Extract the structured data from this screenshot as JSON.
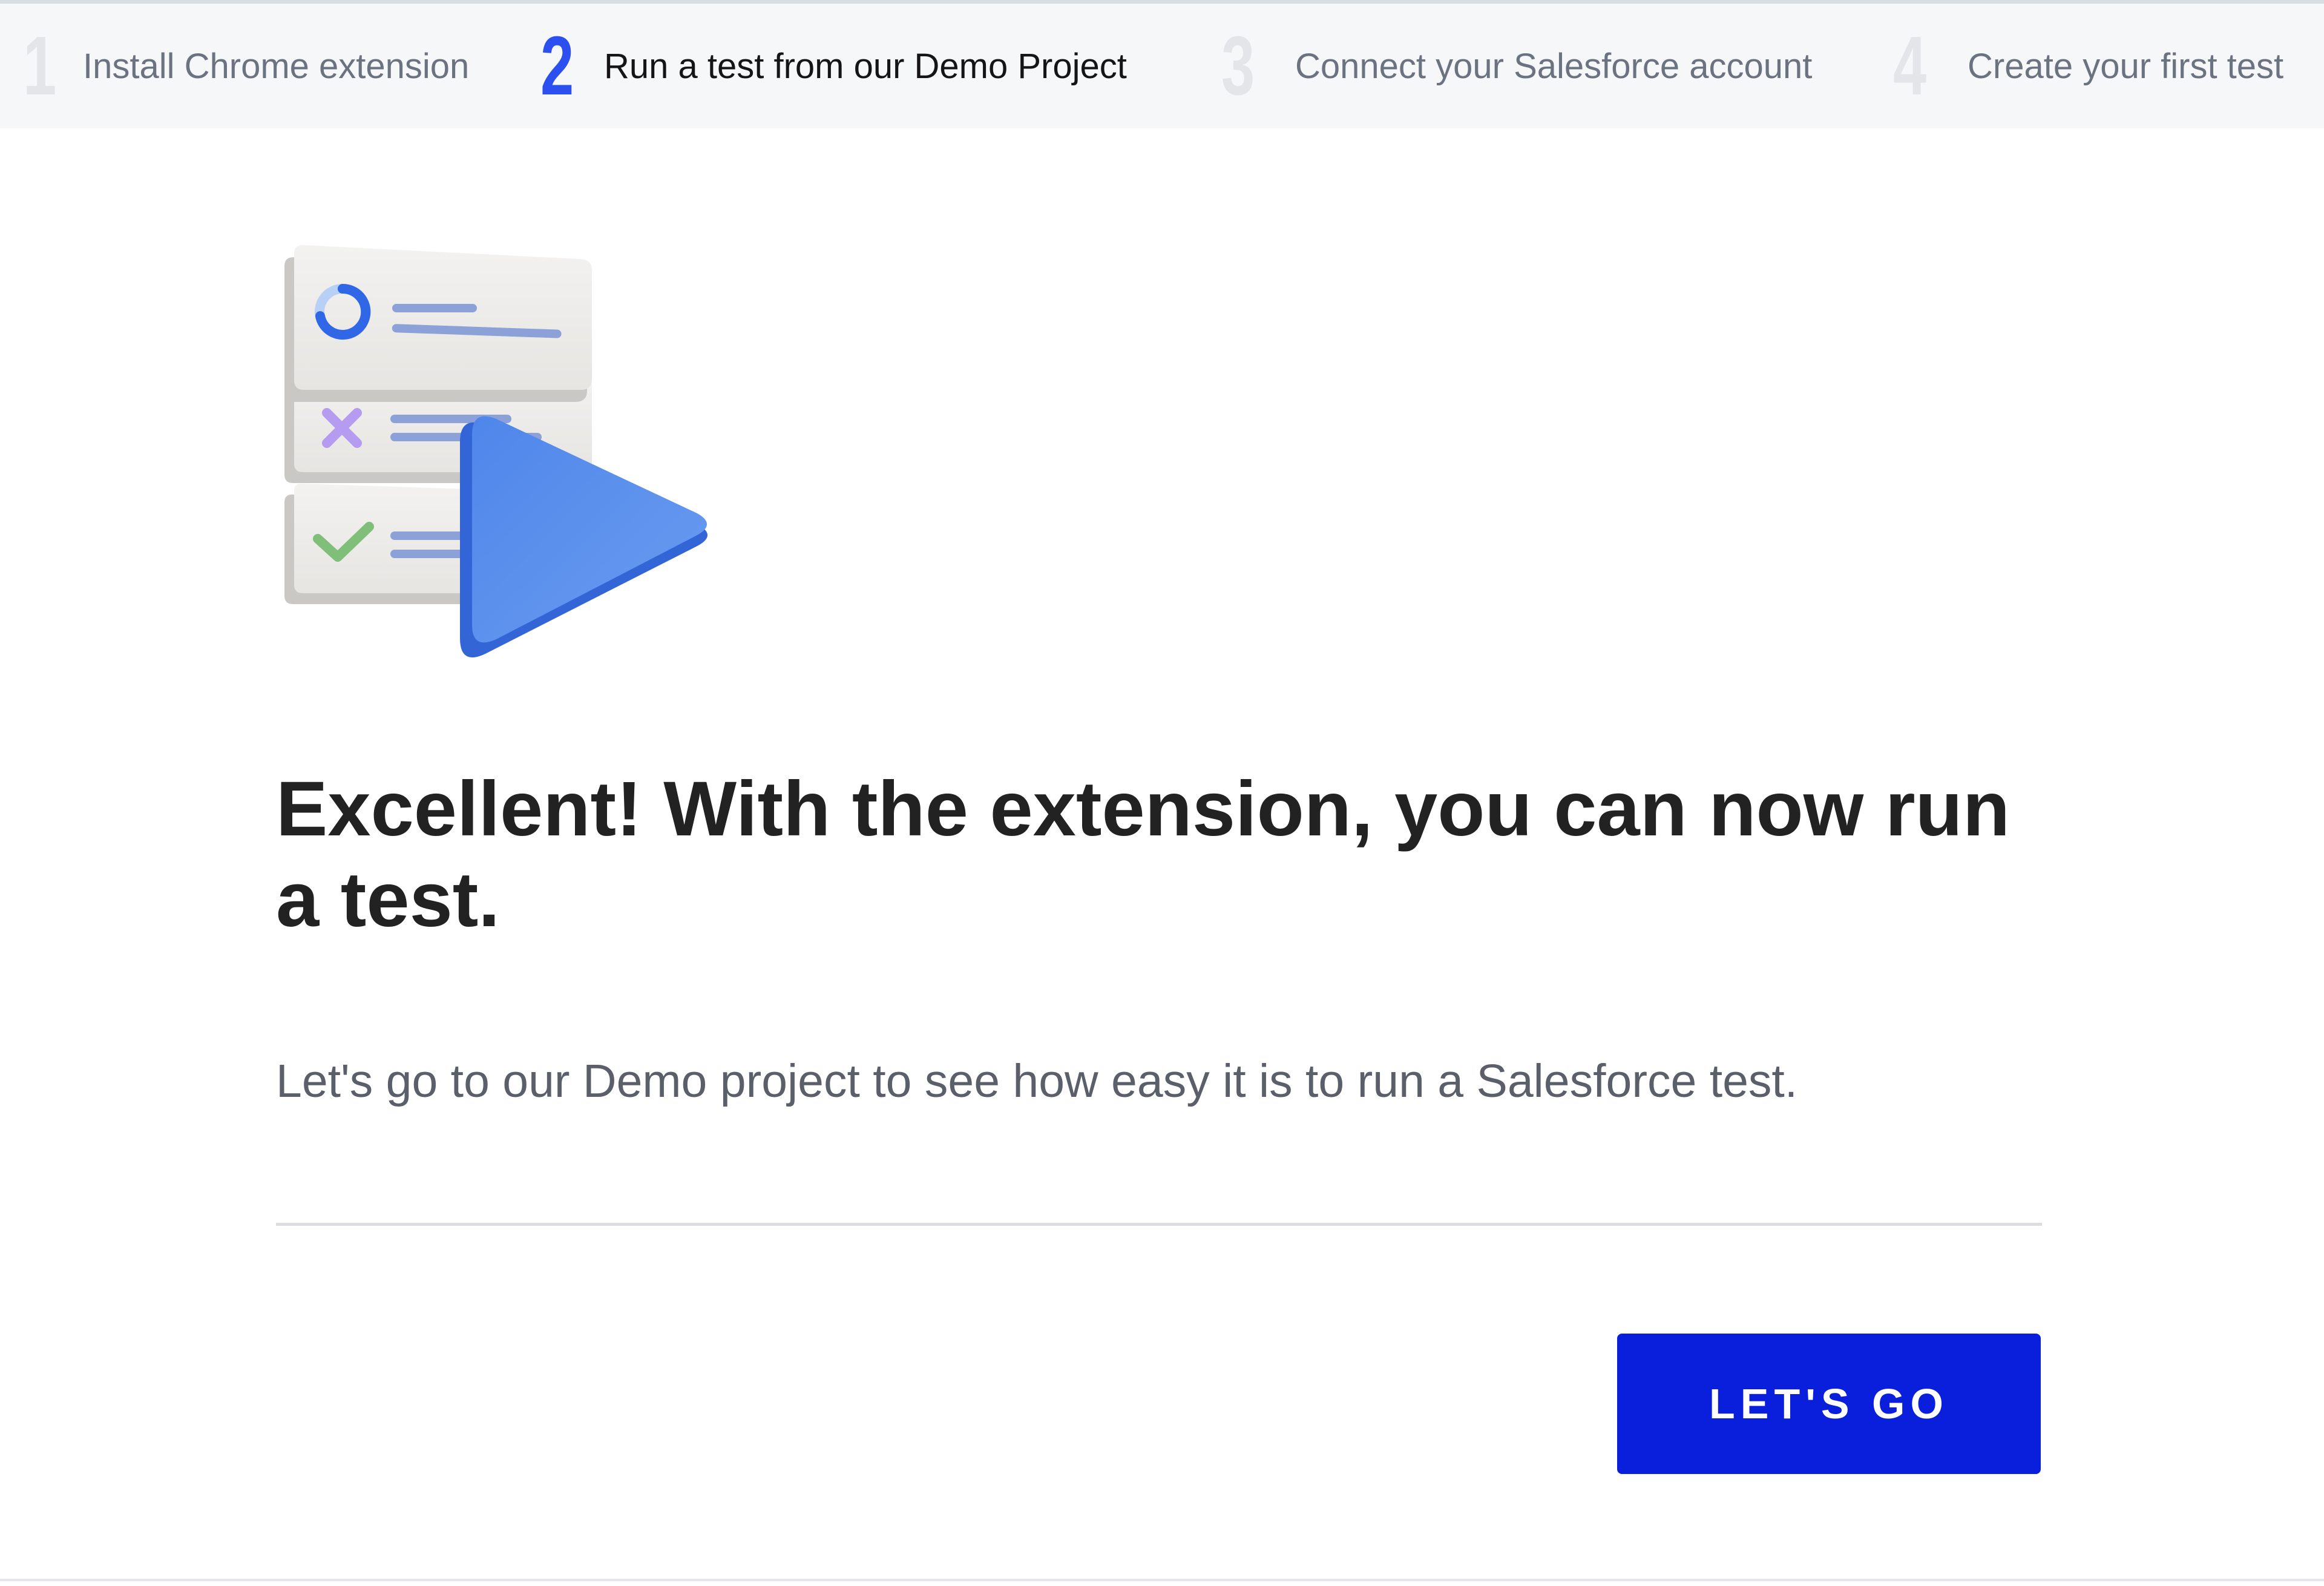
{
  "steps": [
    {
      "number": "1",
      "label": "Install Chrome extension",
      "state": "done"
    },
    {
      "number": "2",
      "label": "Run a test from our Demo Project",
      "state": "active"
    },
    {
      "number": "3",
      "label": "Connect your Salesforce account",
      "state": "todo"
    },
    {
      "number": "4",
      "label": "Create your first test",
      "state": "todo"
    }
  ],
  "content": {
    "heading": "Excellent! With the extension, you can now run a test.",
    "description": "Let's go to our Demo project to see how easy it is to run a Salesforce test.",
    "cta_label": "LET'S GO"
  },
  "colors": {
    "accent": "#2c4ff0",
    "button": "#0a1fdc",
    "play_icon": "#5b8ee8"
  }
}
